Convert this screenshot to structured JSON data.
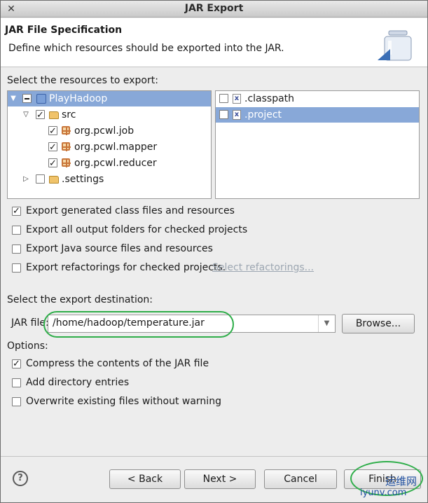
{
  "window": {
    "title": "JAR Export"
  },
  "banner": {
    "heading": "JAR File Specification",
    "description": "Define which resources should be exported into the JAR."
  },
  "resources": {
    "label": "Select the resources to export:",
    "tree": [
      {
        "label": "PlayHadoop",
        "state": "partial",
        "expanded": true,
        "selected": true,
        "icon": "project-icon"
      },
      {
        "label": "src",
        "state": "checked",
        "expanded": true,
        "icon": "source-folder-icon"
      },
      {
        "label": "org.pcwl.job",
        "state": "checked",
        "icon": "package-icon"
      },
      {
        "label": "org.pcwl.mapper",
        "state": "checked",
        "icon": "package-icon"
      },
      {
        "label": "org.pcwl.reducer",
        "state": "checked",
        "icon": "package-icon"
      },
      {
        "label": ".settings",
        "state": "unchecked",
        "expanded": false,
        "icon": "folder-icon"
      }
    ],
    "files": [
      {
        "label": ".classpath",
        "checked": false,
        "selected": false,
        "icon": "xml-file-icon"
      },
      {
        "label": ".project",
        "checked": false,
        "selected": true,
        "icon": "xml-file-icon"
      }
    ]
  },
  "export_options": [
    {
      "label": "Export generated class files and resources",
      "checked": true
    },
    {
      "label": "Export all output folders for checked projects",
      "checked": false
    },
    {
      "label": "Export Java source files and resources",
      "checked": false
    },
    {
      "label": "Export refactorings for checked projects.",
      "checked": false
    }
  ],
  "select_refactorings_link": "Select refactorings...",
  "destination": {
    "label": "Select the export destination:",
    "jar_file_label": "JAR file:",
    "jar_file_value": "/home/hadoop/temperature.jar",
    "browse_label": "Browse..."
  },
  "options": {
    "label": "Options:",
    "items": [
      {
        "label": "Compress the contents of the JAR file",
        "checked": true
      },
      {
        "label": "Add directory entries",
        "checked": false
      },
      {
        "label": "Overwrite existing files without warning",
        "checked": false
      }
    ]
  },
  "buttons": {
    "back": "< Back",
    "next": "Next >",
    "cancel": "Cancel",
    "finish": "Finish"
  },
  "watermark": {
    "line1": "运维网",
    "line2": "iyunv.com"
  },
  "colors": {
    "selection": "#88a8d8",
    "highlight_circle": "#2fae4a",
    "link_disabled": "#9da7b2"
  }
}
